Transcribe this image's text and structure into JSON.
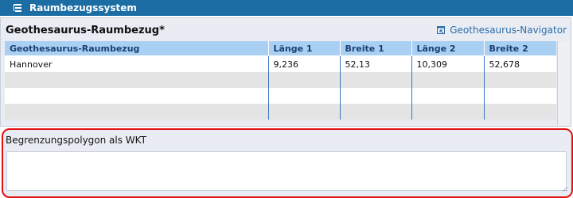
{
  "window": {
    "title": "Raumbezugssystem",
    "title_icon": "document-tree-icon"
  },
  "section": {
    "heading": "Geothesaurus-Raumbezug*",
    "navigator_link": "Geothesaurus-Navigator",
    "navigator_icon": "navigator-window-icon"
  },
  "table": {
    "columns": [
      "Geothesaurus-Raumbezug",
      "Länge 1",
      "Breite 1",
      "Länge 2",
      "Breite 2"
    ],
    "rows": [
      [
        "Hannover",
        "9,236",
        "52,13",
        "10,309",
        "52,678"
      ],
      [
        "",
        "",
        "",
        "",
        ""
      ],
      [
        "",
        "",
        "",
        "",
        ""
      ],
      [
        "",
        "",
        "",
        "",
        ""
      ]
    ]
  },
  "wkt": {
    "label": "Begrenzungspolygon als WKT",
    "value": ""
  },
  "colors": {
    "titlebar": "#1c6da3",
    "header": "#a9cff3",
    "highlight": "#e41010"
  }
}
